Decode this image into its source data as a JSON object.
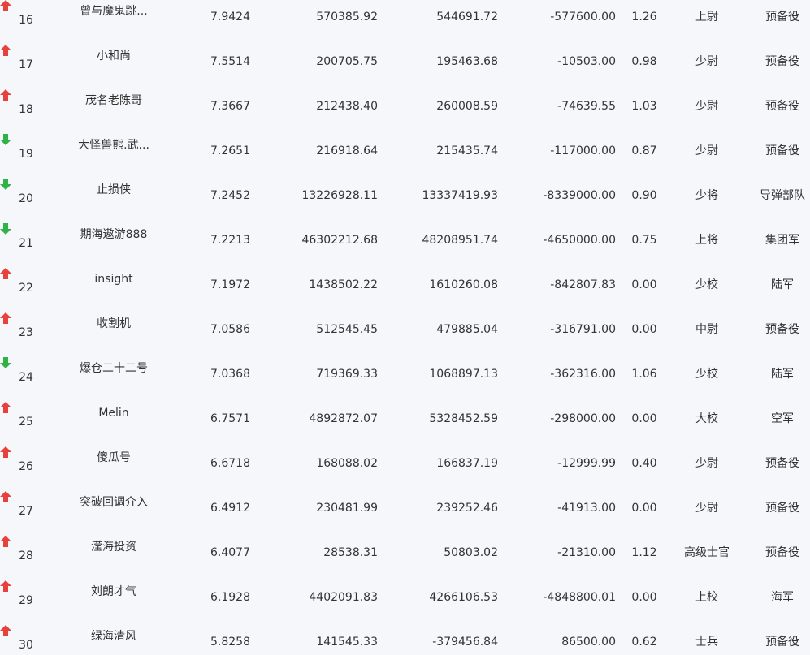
{
  "colors": {
    "background": "#f5f7fa",
    "text": "#333333",
    "trend_up": "#e8413c",
    "trend_down": "#2fb344"
  },
  "rows": [
    {
      "rank": "16",
      "name": "曾与魔鬼跳...",
      "score": "7.9424",
      "trend": "up",
      "v1": "570385.92",
      "v2": "544691.72",
      "v3": "-577600.00",
      "ratio": "1.26",
      "rank_title": "上尉",
      "unit": "预备役"
    },
    {
      "rank": "17",
      "name": "小和尚",
      "score": "7.5514",
      "trend": "up",
      "v1": "200705.75",
      "v2": "195463.68",
      "v3": "-10503.00",
      "ratio": "0.98",
      "rank_title": "少尉",
      "unit": "预备役"
    },
    {
      "rank": "18",
      "name": "茂名老陈哥",
      "score": "7.3667",
      "trend": "up",
      "v1": "212438.40",
      "v2": "260008.59",
      "v3": "-74639.55",
      "ratio": "1.03",
      "rank_title": "少尉",
      "unit": "预备役"
    },
    {
      "rank": "19",
      "name": "大怪兽熊.武...",
      "score": "7.2651",
      "trend": "down",
      "v1": "216918.64",
      "v2": "215435.74",
      "v3": "-117000.00",
      "ratio": "0.87",
      "rank_title": "少尉",
      "unit": "预备役"
    },
    {
      "rank": "20",
      "name": "止损侠",
      "score": "7.2452",
      "trend": "down",
      "v1": "13226928.11",
      "v2": "13337419.93",
      "v3": "-8339000.00",
      "ratio": "0.90",
      "rank_title": "少将",
      "unit": "导弹部队"
    },
    {
      "rank": "21",
      "name": "期海遨游888",
      "score": "7.2213",
      "trend": "down",
      "v1": "46302212.68",
      "v2": "48208951.74",
      "v3": "-4650000.00",
      "ratio": "0.75",
      "rank_title": "上将",
      "unit": "集团军"
    },
    {
      "rank": "22",
      "name": "insight",
      "score": "7.1972",
      "trend": "up",
      "v1": "1438502.22",
      "v2": "1610260.08",
      "v3": "-842807.83",
      "ratio": "0.00",
      "rank_title": "少校",
      "unit": "陆军"
    },
    {
      "rank": "23",
      "name": "收割机",
      "score": "7.0586",
      "trend": "up",
      "v1": "512545.45",
      "v2": "479885.04",
      "v3": "-316791.00",
      "ratio": "0.00",
      "rank_title": "中尉",
      "unit": "预备役"
    },
    {
      "rank": "24",
      "name": "爆仓二十二号",
      "score": "7.0368",
      "trend": "down",
      "v1": "719369.33",
      "v2": "1068897.13",
      "v3": "-362316.00",
      "ratio": "1.06",
      "rank_title": "少校",
      "unit": "陆军"
    },
    {
      "rank": "25",
      "name": "Melin",
      "score": "6.7571",
      "trend": "up",
      "v1": "4892872.07",
      "v2": "5328452.59",
      "v3": "-298000.00",
      "ratio": "0.00",
      "rank_title": "大校",
      "unit": "空军"
    },
    {
      "rank": "26",
      "name": "傻瓜号",
      "score": "6.6718",
      "trend": "up",
      "v1": "168088.02",
      "v2": "166837.19",
      "v3": "-12999.99",
      "ratio": "0.40",
      "rank_title": "少尉",
      "unit": "预备役"
    },
    {
      "rank": "27",
      "name": "突破回调介入",
      "score": "6.4912",
      "trend": "up",
      "v1": "230481.99",
      "v2": "239252.46",
      "v3": "-41913.00",
      "ratio": "0.00",
      "rank_title": "少尉",
      "unit": "预备役"
    },
    {
      "rank": "28",
      "name": "滢海投资",
      "score": "6.4077",
      "trend": "up",
      "v1": "28538.31",
      "v2": "50803.02",
      "v3": "-21310.00",
      "ratio": "1.12",
      "rank_title": "高级士官",
      "unit": "预备役"
    },
    {
      "rank": "29",
      "name": "刘朗才气",
      "score": "6.1928",
      "trend": "up",
      "v1": "4402091.83",
      "v2": "4266106.53",
      "v3": "-4848800.01",
      "ratio": "0.00",
      "rank_title": "上校",
      "unit": "海军"
    },
    {
      "rank": "30",
      "name": "绿海清风",
      "score": "5.8258",
      "trend": "up",
      "v1": "141545.33",
      "v2": "-379456.84",
      "v3": "86500.00",
      "ratio": "0.62",
      "rank_title": "士兵",
      "unit": "预备役"
    }
  ]
}
